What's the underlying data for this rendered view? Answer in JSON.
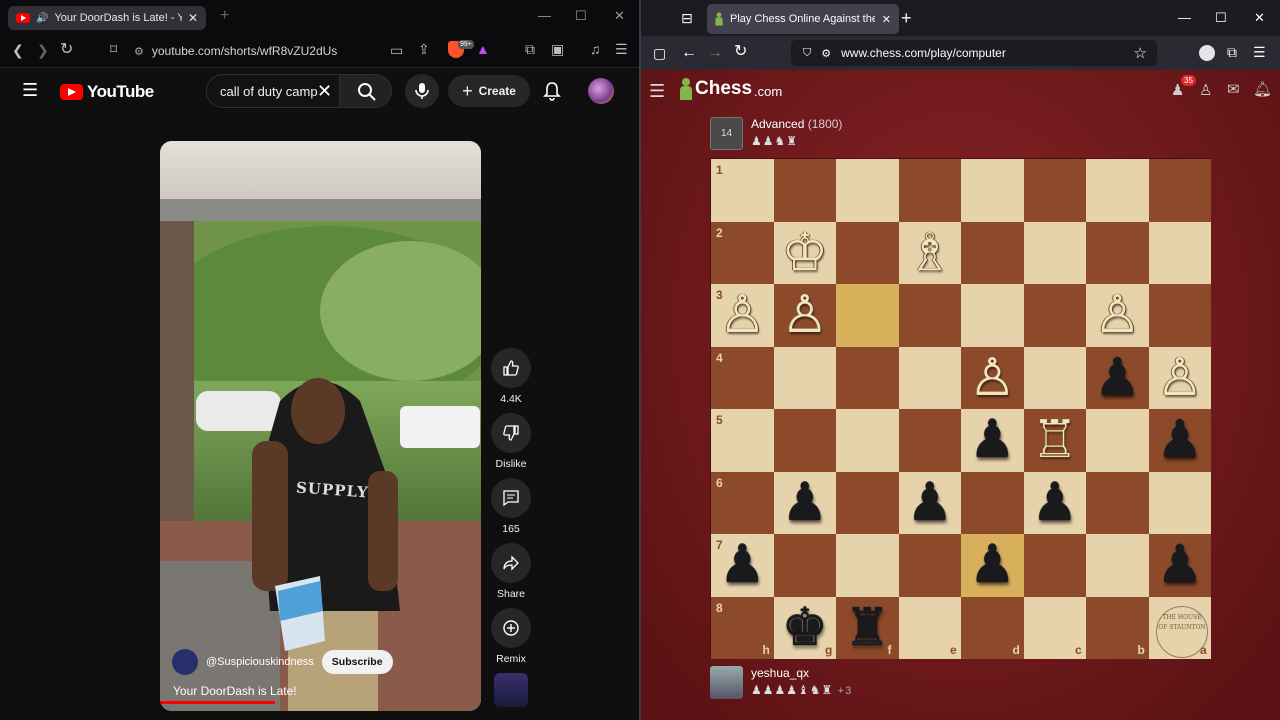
{
  "left_browser": {
    "tab_title": "Your DoorDash is Late! - YouTube",
    "url": "youtube.com/shorts/wfR8vZU2dUs",
    "shields_badge": "99+"
  },
  "youtube": {
    "logo_text": "YouTube",
    "search_value": "call of duty camp",
    "create_label": "Create",
    "short": {
      "channel": "@Suspiciouskindness",
      "subscribe_label": "Subscribe",
      "title": "Your DoorDash is Late!",
      "shirt_text": "SUPPLY"
    },
    "actions": {
      "likes": "4.4K",
      "dislike": "Dislike",
      "comments": "165",
      "share": "Share",
      "remix": "Remix"
    }
  },
  "right_browser": {
    "tab_title": "Play Chess Online Against the Computer",
    "url": "www.chess.com/play/computer"
  },
  "chess": {
    "logo_text": "Chess",
    "logo_suffix": ".com",
    "notification_count": "35",
    "opponent": {
      "level": "14",
      "name": "Advanced",
      "rating": "(1800)",
      "captured": "♟♟♞♜"
    },
    "player": {
      "name": "yeshua_qx",
      "captured": "♟♟♟♟♝♞♜",
      "material": "+3"
    },
    "board_watermark": "THE HOUSE OF STAUNTON",
    "rank_labels": [
      "1",
      "2",
      "3",
      "4",
      "5",
      "6",
      "7",
      "8"
    ],
    "file_labels": [
      "h",
      "g",
      "f",
      "e",
      "d",
      "c",
      "b",
      "a"
    ],
    "pieces": [
      {
        "square": "g2",
        "piece": "K",
        "color": "w"
      },
      {
        "square": "e2",
        "piece": "B",
        "color": "w"
      },
      {
        "square": "h3",
        "piece": "P",
        "color": "w"
      },
      {
        "square": "g3",
        "piece": "P",
        "color": "w"
      },
      {
        "square": "b3",
        "piece": "P",
        "color": "w"
      },
      {
        "square": "d4",
        "piece": "P",
        "color": "w"
      },
      {
        "square": "a4",
        "piece": "P",
        "color": "w"
      },
      {
        "square": "c5",
        "piece": "R",
        "color": "w"
      },
      {
        "square": "b4",
        "piece": "P",
        "color": "b"
      },
      {
        "square": "d5",
        "piece": "P",
        "color": "b"
      },
      {
        "square": "a5",
        "piece": "P",
        "color": "b"
      },
      {
        "square": "g6",
        "piece": "P",
        "color": "b"
      },
      {
        "square": "e6",
        "piece": "P",
        "color": "b"
      },
      {
        "square": "c6",
        "piece": "P",
        "color": "b"
      },
      {
        "square": "h7",
        "piece": "P",
        "color": "b"
      },
      {
        "square": "d7",
        "piece": "P",
        "color": "b"
      },
      {
        "square": "a7",
        "piece": "P",
        "color": "b"
      },
      {
        "square": "g8",
        "piece": "K",
        "color": "b"
      },
      {
        "square": "f8",
        "piece": "R",
        "color": "b"
      }
    ],
    "highlights": [
      "f3",
      "d7"
    ]
  },
  "colors": {
    "light_square": "#e6d3ac",
    "dark_square": "#8c4a2a",
    "highlight": "#d8b05c",
    "youtube_red": "#ff0000",
    "chess_green": "#81b64c"
  }
}
